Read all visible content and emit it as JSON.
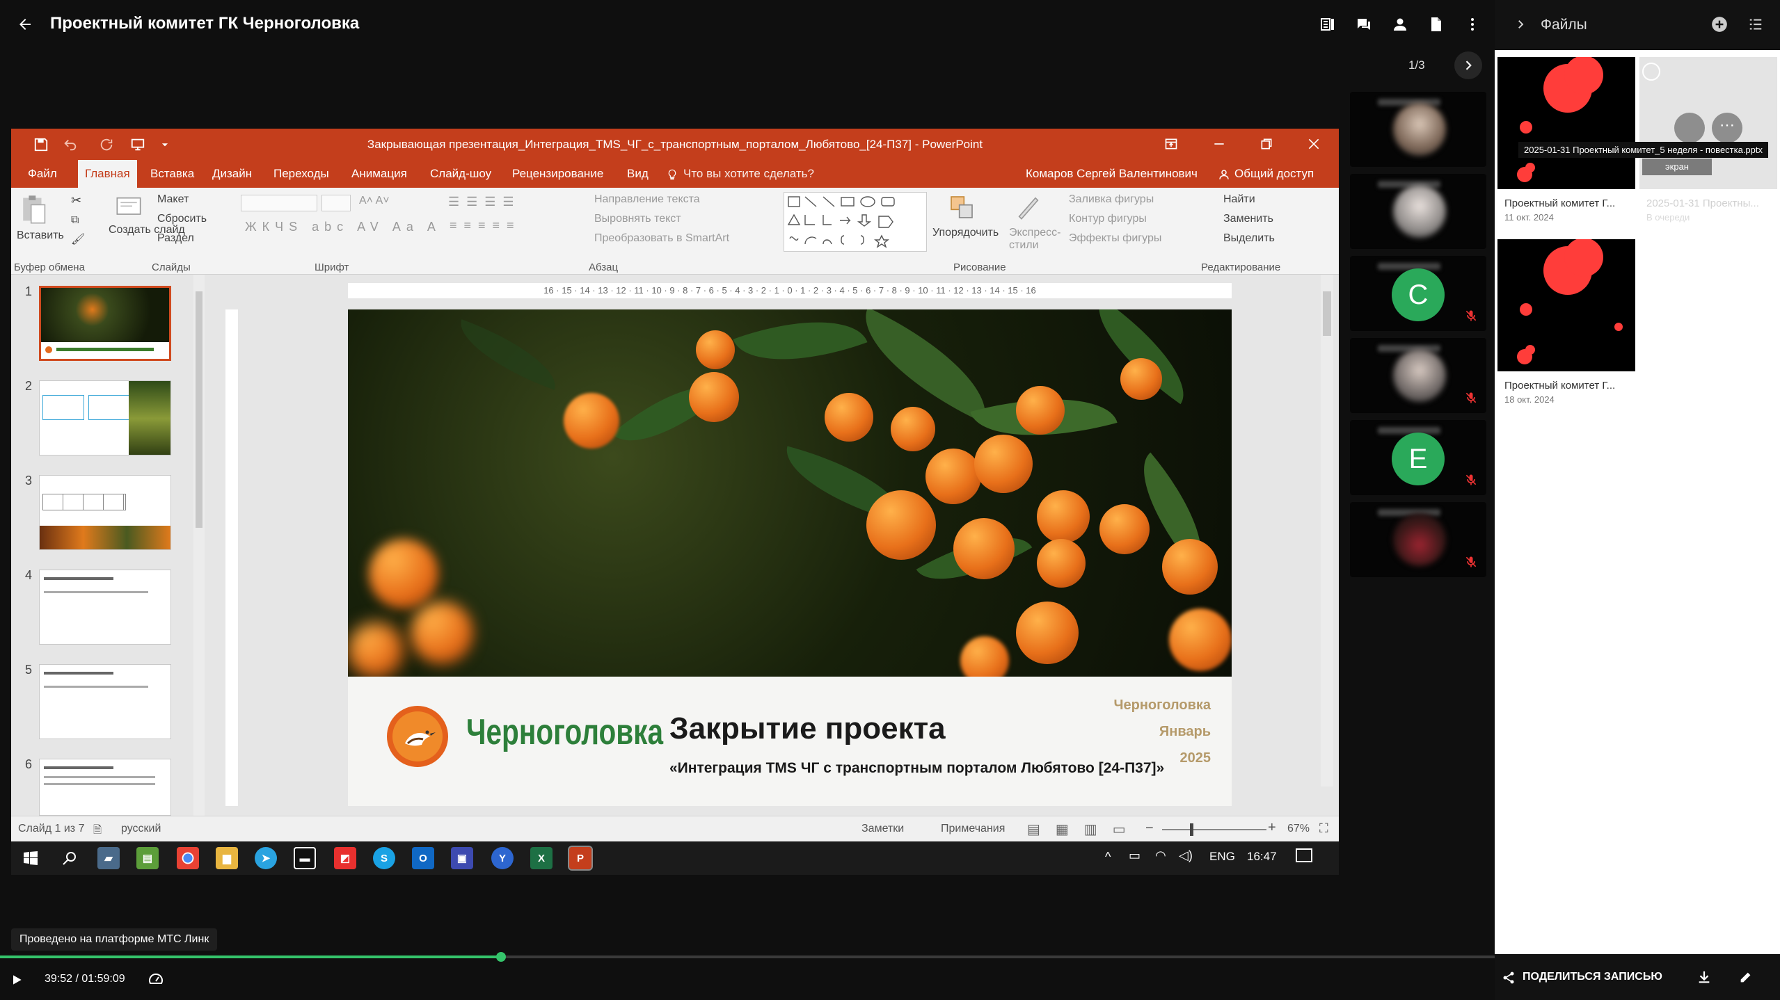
{
  "header": {
    "title": "Проектный комитет ГК Черноголовка",
    "page_indicator": "1/3"
  },
  "files_panel": {
    "title": "Файлы",
    "tooltip": "2025-01-31 Проектный комитет_5 неделя - повестка.pptx",
    "screen_label": "экран",
    "files": [
      {
        "name": "Проектный комитет Г...",
        "date": "11 окт. 2024"
      },
      {
        "name": "2025-01-31 Проектны...",
        "date": "В очереди"
      },
      {
        "name": "Проектный комитет Г...",
        "date": "18 окт. 2024"
      }
    ]
  },
  "participants": [
    {
      "avatar_letter": "",
      "type": "photo"
    },
    {
      "avatar_letter": "",
      "type": "photo"
    },
    {
      "avatar_letter": "С",
      "type": "avatar"
    },
    {
      "avatar_letter": "",
      "type": "photo"
    },
    {
      "avatar_letter": "Е",
      "type": "avatar"
    },
    {
      "avatar_letter": "",
      "type": "photo"
    }
  ],
  "powerpoint": {
    "window_title": "Закрывающая презентация_Интеграция_TMS_ЧГ_с_транспортным_порталом_Любятово_[24-П37] - PowerPoint",
    "tabs": [
      "Файл",
      "Главная",
      "Вставка",
      "Дизайн",
      "Переходы",
      "Анимация",
      "Слайд-шоу",
      "Рецензирование",
      "Вид"
    ],
    "tell_me": "Что вы хотите сделать?",
    "user": "Комаров Сергей Валентинович",
    "share": "Общий доступ",
    "ribbon": {
      "paste": "Вставить",
      "create_slide": "Создать слайд",
      "layout": "Макет",
      "reset": "Сбросить",
      "section": "Раздел",
      "text_direction": "Направление текста",
      "align_text": "Выровнять текст",
      "smartart": "Преобразовать в SmartArt",
      "arrange": "Упорядочить",
      "quick_styles": "Экспресс-стили",
      "fill": "Заливка фигуры",
      "outline": "Контур фигуры",
      "effects": "Эффекты фигуры",
      "find": "Найти",
      "replace": "Заменить",
      "select": "Выделить",
      "groups": [
        "Буфер обмена",
        "Слайды",
        "Шрифт",
        "Абзац",
        "Рисование",
        "Редактирование"
      ]
    },
    "thumbnails": [
      "1",
      "2",
      "3",
      "4",
      "5",
      "6"
    ],
    "ruler": "16 · 15 · 14 · 13 · 12 · 11 · 10 · 9 · 8 · 7 · 6 · 5 · 4 · 3 · 2 · 1 · 0 · 1 · 2 · 3 · 4 · 5 · 6 · 7 · 8 · 9 · 10 · 11 · 12 · 13 · 14 · 15 · 16",
    "slide": {
      "brand": "Черноголовка",
      "title": "Закрытие проекта",
      "subtitle": "«Интеграция TMS ЧГ с транспортным порталом Любятово [24-П37]»",
      "right_city": "Черноголовка",
      "right_month": "Январь",
      "right_year": "2025"
    },
    "status": {
      "slide": "Слайд 1 из 7",
      "language": "русский",
      "notes": "Заметки",
      "comments": "Примечания",
      "zoom": "67%"
    }
  },
  "taskbar": {
    "language": "ENG",
    "time": "16:47"
  },
  "player": {
    "platform_badge": "Проведено на платформе МТС Линк",
    "time": "39:52 / 01:59:09",
    "progress": 0.335,
    "share_label": "ПОДЕЛИТЬСЯ ЗАПИСЬЮ"
  }
}
